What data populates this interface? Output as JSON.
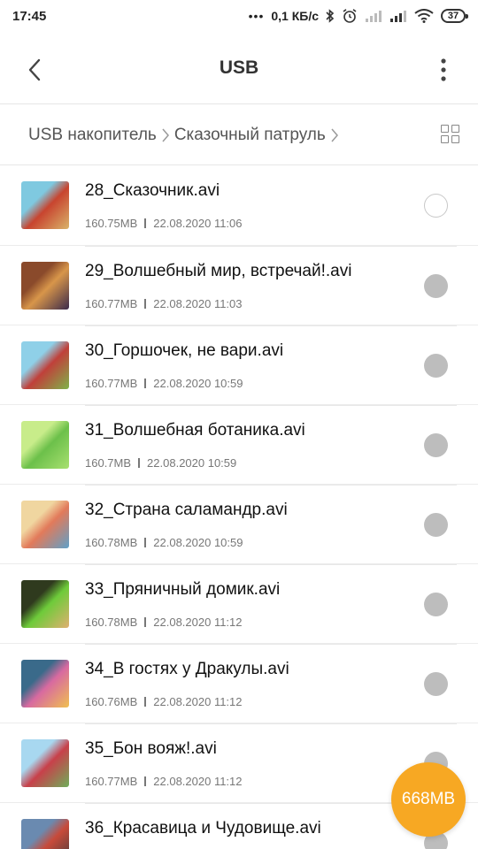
{
  "status_bar": {
    "time": "17:45",
    "dots": "•••",
    "network_speed": "0,1 КБ/с",
    "battery_level": "37",
    "icons": [
      "bluetooth-icon",
      "alarm-icon",
      "signal-icon",
      "signal-icon",
      "wifi-icon",
      "battery-icon"
    ]
  },
  "header": {
    "title": "USB",
    "back_icon": "chevron-left-icon",
    "more_icon": "more-vertical-icon"
  },
  "breadcrumb": {
    "items": [
      "USB накопитель",
      "Сказочный патруль"
    ],
    "view_toggle_icon": "grid-view-icon"
  },
  "files": [
    {
      "name": "28_Сказочник.avi",
      "size": "160.75MB",
      "date": "22.08.2020 11:06",
      "selected_state": "empty",
      "thumb_colors": [
        "#7fc9e0",
        "#c8442f",
        "#d9b46a"
      ]
    },
    {
      "name": "29_Волшебный мир, встречай!.avi",
      "size": "160.77MB",
      "date": "22.08.2020 11:03",
      "selected_state": "filled",
      "thumb_colors": [
        "#8a4a2b",
        "#d8964a",
        "#3b2a4a"
      ]
    },
    {
      "name": "30_Горшочек, не вари.avi",
      "size": "160.77MB",
      "date": "22.08.2020 10:59",
      "selected_state": "filled",
      "thumb_colors": [
        "#8fd0e8",
        "#c0403a",
        "#7fb34a"
      ]
    },
    {
      "name": "31_Волшебная ботаника.avi",
      "size": "160.7MB",
      "date": "22.08.2020 10:59",
      "selected_state": "filled",
      "thumb_colors": [
        "#c8ec8a",
        "#6cc04a",
        "#a8e070"
      ]
    },
    {
      "name": "32_Страна саламандр.avi",
      "size": "160.78MB",
      "date": "22.08.2020 10:59",
      "selected_state": "filled",
      "thumb_colors": [
        "#f0d6a0",
        "#e27a5a",
        "#5fa0c8"
      ]
    },
    {
      "name": "33_Пряничный домик.avi",
      "size": "160.78MB",
      "date": "22.08.2020 11:12",
      "selected_state": "filled",
      "thumb_colors": [
        "#2f3a1e",
        "#6ecb3a",
        "#e0b070"
      ]
    },
    {
      "name": "34_В гостях у Дракулы.avi",
      "size": "160.76MB",
      "date": "22.08.2020 11:12",
      "selected_state": "filled",
      "thumb_colors": [
        "#3a6a8a",
        "#d86aa0",
        "#f0c050"
      ]
    },
    {
      "name": "35_Бон вояж!.avi",
      "size": "160.77MB",
      "date": "22.08.2020 11:12",
      "selected_state": "filled",
      "thumb_colors": [
        "#a8d8f0",
        "#c8404a",
        "#6fae5a"
      ]
    },
    {
      "name": "36_Красавица и Чудовище.avi",
      "size": "",
      "date": "",
      "selected_state": "filled",
      "thumb_colors": [
        "#6a8ab0",
        "#c84a3a",
        "#3a3a3a"
      ]
    }
  ],
  "selection_badge": {
    "label": "668MB",
    "color": "#f7a823"
  }
}
